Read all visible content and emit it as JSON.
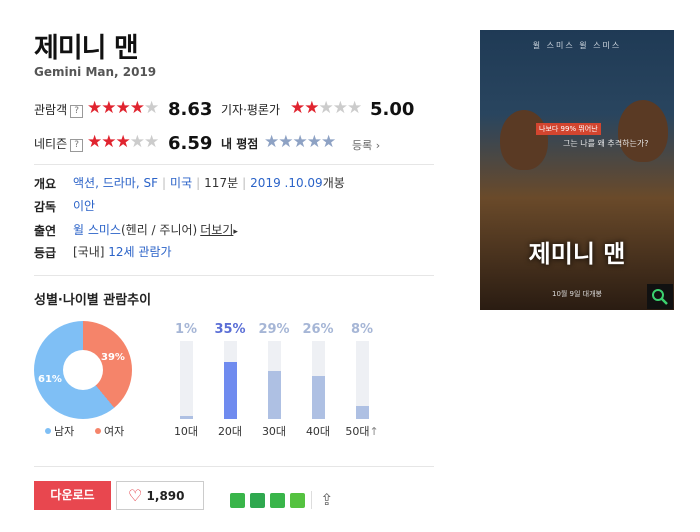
{
  "movie": {
    "title": "제미니 맨",
    "subtitle": "Gemini Man, 2019"
  },
  "ratings": {
    "audience": {
      "label": "관람객",
      "help": "?",
      "score": "8.63",
      "stars": 4.3
    },
    "critics": {
      "label": "기자·평론가",
      "score": "5.00",
      "stars": 2.5
    },
    "netizen": {
      "label": "네티즌",
      "help": "?",
      "score": "6.59",
      "stars": 3.3
    },
    "mine": {
      "label": "내 평점",
      "register": "등록 ›"
    }
  },
  "info": {
    "overview_label": "개요",
    "genres": "액션, 드라마, SF",
    "country": "미국",
    "runtime": "117분",
    "release": "2019 .10.09",
    "release_suffix": "개봉",
    "director_label": "감독",
    "director": "이안",
    "cast_label": "출연",
    "cast": "윌 스미스",
    "cast_role": "(헨리 / 주니어)",
    "more": "더보기",
    "grade_label": "등급",
    "grade_prefix": "[국내]",
    "grade": "12세 관람가"
  },
  "trend": {
    "title": "성별·나이별 관람추이",
    "gender": {
      "male_pct": 61,
      "female_pct": 39,
      "male_label": "남자",
      "female_label": "여자",
      "male_text": "61%",
      "female_text": "39%"
    },
    "ages": [
      {
        "label": "10대",
        "pct": 1,
        "text": "1%",
        "highlight": false
      },
      {
        "label": "20대",
        "pct": 35,
        "text": "35%",
        "highlight": true
      },
      {
        "label": "30대",
        "pct": 29,
        "text": "29%",
        "highlight": false
      },
      {
        "label": "40대",
        "pct": 26,
        "text": "26%",
        "highlight": false
      },
      {
        "label": "50대",
        "pct": 8,
        "text": "8%",
        "highlight": false,
        "suffix": "↑"
      }
    ]
  },
  "actions": {
    "download": "다운로드",
    "likes": "1,890",
    "share_icons": [
      "blog-icon",
      "me2-icon",
      "bookmark-icon",
      "other-icon"
    ]
  },
  "poster": {
    "top_text": "윌 스미스          윌 스미스",
    "tag": "나보다 99% 뛰어난",
    "question": "그는 나를 왜 추격하는가?",
    "title": "제미니 맨",
    "date": "10월 9일 대개봉"
  },
  "colors": {
    "male": "#7fbff5",
    "female": "#f5846a",
    "accent": "#e0242f",
    "link": "#2b63c8",
    "highlight_bar": "#6f8bef",
    "normal_bar": "#aec0e3"
  }
}
